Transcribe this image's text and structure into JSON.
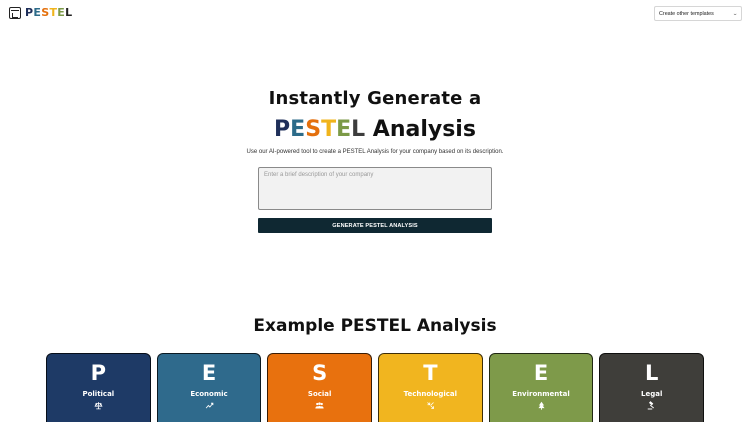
{
  "header": {
    "logo_letters": [
      {
        "char": "P",
        "color": "#1f2f5a"
      },
      {
        "char": "E",
        "color": "#2c6b89"
      },
      {
        "char": "S",
        "color": "#e4700d"
      },
      {
        "char": "T",
        "color": "#f0b41c"
      },
      {
        "char": "E",
        "color": "#7c9a47"
      },
      {
        "char": "L",
        "color": "#222222"
      }
    ],
    "template_select": {
      "label": "Create other templates",
      "icon": "chevron-down-icon"
    }
  },
  "hero": {
    "title_line1": "Instantly Generate a",
    "title_letters": [
      {
        "char": "P",
        "color": "#1f2f5a"
      },
      {
        "char": "E",
        "color": "#2c6b89"
      },
      {
        "char": "S",
        "color": "#e4700d"
      },
      {
        "char": "T",
        "color": "#f0b41c"
      },
      {
        "char": "E",
        "color": "#7c9a47"
      },
      {
        "char": "L",
        "color": "#3d3d3d"
      }
    ],
    "title_suffix": " Analysis",
    "subtitle": "Use our AI-powered tool to create a PESTEL Analysis for your company based on its description.",
    "input_placeholder": "Enter a brief description of your company",
    "input_value": "",
    "button_label": "GENERATE PESTEL ANALYSIS"
  },
  "example": {
    "title": "Example PESTEL Analysis",
    "cards": [
      {
        "letter": "P",
        "label": "Political",
        "icon": "scales-icon",
        "color": "#1e3a66"
      },
      {
        "letter": "E",
        "label": "Economic",
        "icon": "trend-up-icon",
        "color": "#2f6a8c"
      },
      {
        "letter": "S",
        "label": "Social",
        "icon": "people-icon",
        "color": "#e8710e"
      },
      {
        "letter": "T",
        "label": "Technological",
        "icon": "chip-icon",
        "color": "#f1b51f"
      },
      {
        "letter": "E",
        "label": "Environmental",
        "icon": "tree-icon",
        "color": "#7e9a4a"
      },
      {
        "letter": "L",
        "label": "Legal",
        "icon": "gavel-icon",
        "color": "#3f3e3a"
      }
    ]
  }
}
